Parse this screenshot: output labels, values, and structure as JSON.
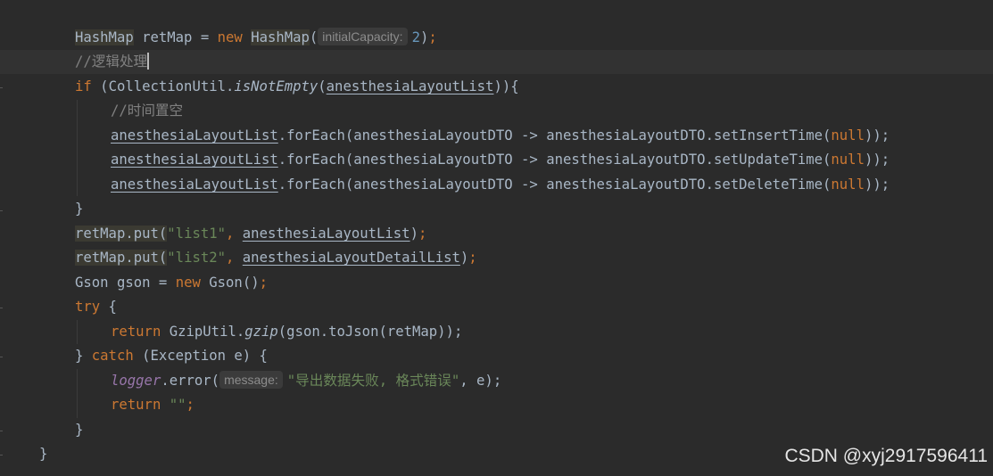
{
  "watermark": "CSDN @xyj2917596411",
  "tokens": {
    "HashMap": "HashMap",
    "retMap": "retMap",
    "eq": " = ",
    "new": "new",
    "lp": "(",
    "rp": ")",
    "semi": ";",
    "initialCapacity": "initialCapacity:",
    "two": "2",
    "comment_logic": "//逻辑处理",
    "if": "if",
    "CollectionUtil": "CollectionUtil",
    "isNotEmpty": "isNotEmpty",
    "anesthesiaLayoutList": "anesthesiaLayoutList",
    "comment_time": "//时间置空",
    "forEach_open": ".forEach(anesthesiaLayoutDTO -> anesthesiaLayoutDTO.",
    "setInsertTime": "setInsertTime(",
    "setUpdateTime": "setUpdateTime(",
    "setDeleteTime": "setDeleteTime(",
    "null": "null",
    "close_brace": "}",
    "put": ".put(",
    "list1": "\"list1\"",
    "list2": "\"list2\"",
    "comma": ", ",
    "anesthesiaLayoutDetailList": "anesthesiaLayoutDetailList",
    "Gson": "Gson",
    "gson_var": " gson",
    "try": "try",
    "return": "return",
    "GzipUtil": "GzipUtil.",
    "gzip": "gzip",
    "toJson": "(gson.toJson(retMap));",
    "catch": "catch",
    "exception": "(Exception e) {",
    "logger": "logger",
    "error": ".error(",
    "message": "message:",
    "err_str": "\"导出数据失败, 格式错误\"",
    "e_close": ", e);",
    "empty_str": "\"\""
  }
}
